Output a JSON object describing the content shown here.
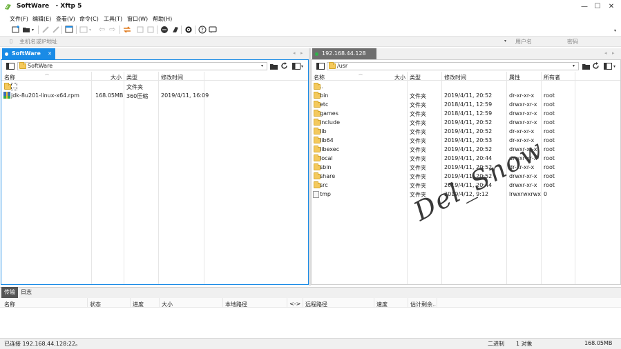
{
  "window": {
    "title_app": "SoftWare",
    "title_sep": "- Xftp 5",
    "minimize": "—",
    "maximize": "☐",
    "close": "✕"
  },
  "menu": [
    "文件(F)",
    "编辑(E)",
    "查看(V)",
    "命令(C)",
    "工具(T)",
    "窗口(W)",
    "帮助(H)"
  ],
  "address": {
    "host_placeholder": "主机名或IP地址",
    "user_placeholder": "用户名",
    "pass_placeholder": "密码"
  },
  "left": {
    "tab_label": "SoftWare",
    "path": "SoftWare",
    "headers": [
      "名称",
      "大小",
      "类型",
      "修改时间"
    ],
    "rows": [
      {
        "name": "..",
        "size": "",
        "type": "文件夹",
        "time": ""
      },
      {
        "name": "jdk-8u201-linux-x64.rpm",
        "size": "168.05MB",
        "type": "360压缩",
        "time": "2019/4/11, 16:09"
      }
    ]
  },
  "right": {
    "tab_label": "192.168.44.128",
    "path": "/usr",
    "headers": [
      "名称",
      "大小",
      "类型",
      "修改时间",
      "属性",
      "所有者"
    ],
    "rows": [
      {
        "name": "..",
        "type": "",
        "time": "",
        "attr": "",
        "owner": ""
      },
      {
        "name": "bin",
        "type": "文件夹",
        "time": "2019/4/11, 20:52",
        "attr": "dr-xr-xr-x",
        "owner": "root"
      },
      {
        "name": "etc",
        "type": "文件夹",
        "time": "2018/4/11, 12:59",
        "attr": "drwxr-xr-x",
        "owner": "root"
      },
      {
        "name": "games",
        "type": "文件夹",
        "time": "2018/4/11, 12:59",
        "attr": "drwxr-xr-x",
        "owner": "root"
      },
      {
        "name": "include",
        "type": "文件夹",
        "time": "2019/4/11, 20:52",
        "attr": "drwxr-xr-x",
        "owner": "root"
      },
      {
        "name": "lib",
        "type": "文件夹",
        "time": "2019/4/11, 20:52",
        "attr": "dr-xr-xr-x",
        "owner": "root"
      },
      {
        "name": "lib64",
        "type": "文件夹",
        "time": "2019/4/11, 20:53",
        "attr": "dr-xr-xr-x",
        "owner": "root"
      },
      {
        "name": "libexec",
        "type": "文件夹",
        "time": "2019/4/11, 20:52",
        "attr": "drwxr-xr-x",
        "owner": "root"
      },
      {
        "name": "local",
        "type": "文件夹",
        "time": "2019/4/11, 20:44",
        "attr": "drwxr-xr-x",
        "owner": "root"
      },
      {
        "name": "sbin",
        "type": "文件夹",
        "time": "2019/4/11, 20:52",
        "attr": "dr-xr-xr-x",
        "owner": "root"
      },
      {
        "name": "share",
        "type": "文件夹",
        "time": "2019/4/11, 20:52",
        "attr": "drwxr-xr-x",
        "owner": "root"
      },
      {
        "name": "src",
        "type": "文件夹",
        "time": "2019/4/11, 20:44",
        "attr": "drwxr-xr-x",
        "owner": "root"
      },
      {
        "name": "tmp",
        "type": "文件夹",
        "time": "2019/4/12, 9:12",
        "attr": "lrwxrwxrwx",
        "owner": "0"
      }
    ]
  },
  "transfer": {
    "tabs": [
      "传输",
      "日志"
    ],
    "headers": [
      "名称",
      "状态",
      "进度",
      "大小",
      "本地路径",
      "<->",
      "远程路径",
      "速度",
      "估计剩余..."
    ]
  },
  "status": {
    "connection": "已连接 192.168.44.128:22。",
    "mode": "二进制",
    "objects": "1 对象",
    "size": "168.05MB"
  },
  "watermark": "Del_Snow",
  "colors": {
    "accent": "#1a8be6",
    "connected_dot": "#2fb44a",
    "tab_inactive": "#6e6e6e"
  }
}
